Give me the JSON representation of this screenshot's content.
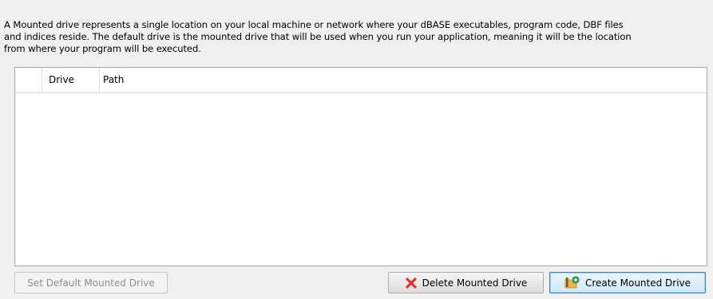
{
  "description": {
    "line1": "A Mounted drive represents a single location on your local machine or network where your dBASE executables, program code, DBF files",
    "line2": "and indices reside. The default drive is the mounted drive that will be used when you run your application, meaning it will be the location",
    "line3": "from where your program will be executed."
  },
  "table": {
    "columns": [
      "",
      "Drive",
      "Path"
    ],
    "rows": []
  },
  "buttons": {
    "set_default": "Set Default Mounted Drive",
    "delete": "Delete Mounted Drive",
    "create": "Create Mounted Drive"
  },
  "icons": {
    "delete": "red-x-icon",
    "create": "folder-add-icon"
  },
  "colors": {
    "background": "#f0f0f0",
    "delete_icon": "#d9362b",
    "create_accent": "#3c7fb1"
  }
}
